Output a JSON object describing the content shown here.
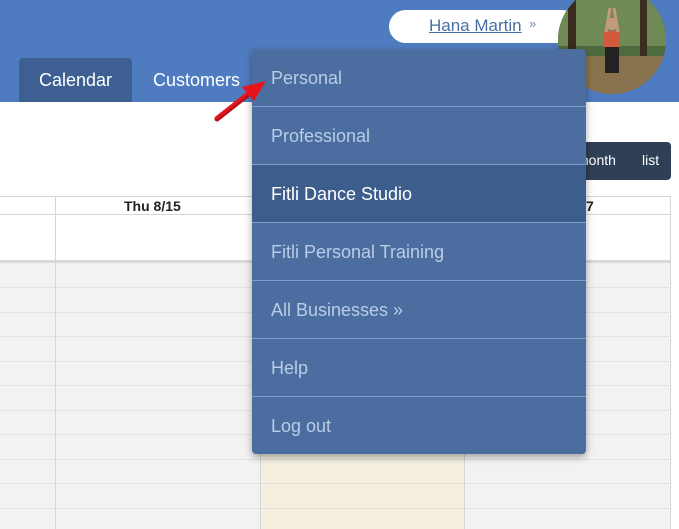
{
  "header": {
    "user_name": "Hana Martin",
    "user_chevron": "»"
  },
  "tabs": [
    {
      "label": "Calendar",
      "active": true
    },
    {
      "label": "Customers",
      "active": false
    }
  ],
  "view_switch": {
    "month_partial": "month",
    "list": "list"
  },
  "calendar": {
    "day_headers": [
      "Thu 8/15",
      "7"
    ]
  },
  "menu": {
    "items": [
      {
        "label": "Personal",
        "active": false
      },
      {
        "label": "Professional",
        "active": false
      },
      {
        "label": "Fitli Dance Studio",
        "active": true
      },
      {
        "label": "Fitli Personal Training",
        "active": false
      },
      {
        "label": "All Businesses »",
        "active": false
      },
      {
        "label": "Help",
        "active": false
      },
      {
        "label": "Log out",
        "active": false
      }
    ]
  },
  "colors": {
    "header_bg": "#4f7cc0",
    "menu_bg": "#4b6da0",
    "menu_active_bg": "#3d5d8c",
    "today_bg": "#f4efde",
    "arrow": "#e8141b"
  }
}
